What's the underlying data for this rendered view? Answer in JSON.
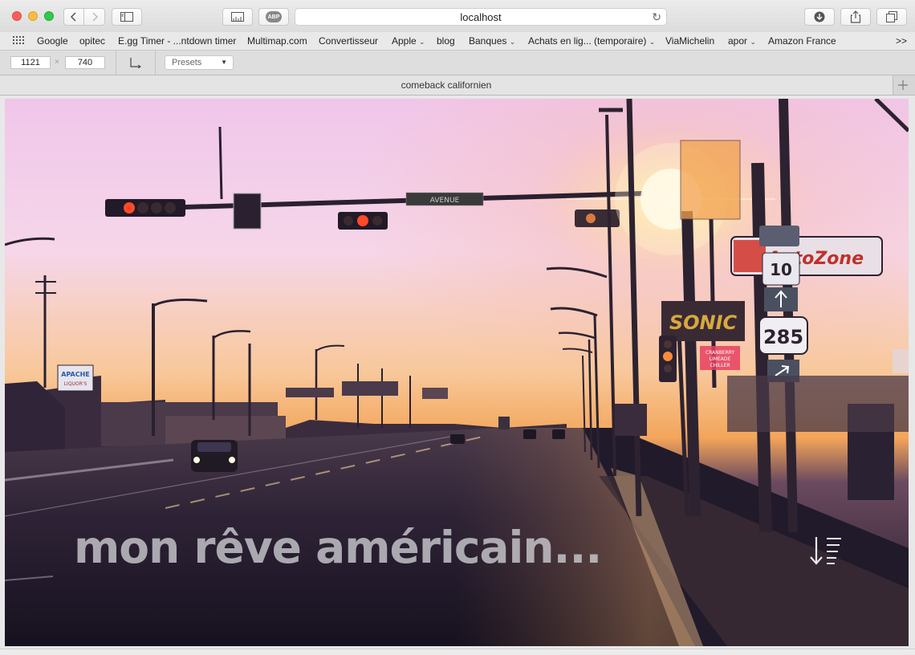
{
  "window": {
    "address": "localhost",
    "tab_title": "comeback californien"
  },
  "toolbar": {
    "back_icon": "chevron-left-icon",
    "forward_icon": "chevron-right-icon",
    "sidebar_icon": "sidebar-icon",
    "responsive_icon": "responsive-design-icon",
    "adblock_label": "ABP",
    "reload_icon": "reload-icon",
    "download_icon": "download-icon",
    "share_icon": "share-icon",
    "tabs_icon": "tabs-overview-icon"
  },
  "bookmarks": [
    {
      "label": "Google",
      "has_menu": false
    },
    {
      "label": "opitec",
      "has_menu": false
    },
    {
      "label": "E.gg Timer - ...ntdown timer",
      "has_menu": false
    },
    {
      "label": "Multimap.com",
      "has_menu": false
    },
    {
      "label": "Convertisseur",
      "has_menu": false
    },
    {
      "label": "Apple",
      "has_menu": true
    },
    {
      "label": "blog",
      "has_menu": false
    },
    {
      "label": "Banques",
      "has_menu": true
    },
    {
      "label": "Achats en lig... (temporaire)",
      "has_menu": true
    },
    {
      "label": "ViaMichelin",
      "has_menu": false
    },
    {
      "label": "apor",
      "has_menu": true
    },
    {
      "label": "Amazon France",
      "has_menu": false
    }
  ],
  "bookmarks_overflow": ">>",
  "responsive": {
    "width": "1121",
    "separator": "×",
    "height": "740",
    "presets_label": "Presets"
  },
  "page": {
    "hero_title": "mon rêve américain...",
    "scroll_icon": "sort-down-icon",
    "photo_signs": {
      "street": "AVENUE",
      "store": "APACHE LIQUOR'S",
      "autozone": "AutoZone",
      "sonic": "SONIC",
      "limeade": "CRANBERRY LIMEADE CHILLER",
      "route_10": "10",
      "route_285": "285"
    }
  },
  "colors": {
    "sky_top": "#f3c8e8",
    "sky_horizon": "#f6b46a",
    "sun": "#fff6d8",
    "road": "#2a2233",
    "close": "#fc605c",
    "minimize": "#fdbc40",
    "maximize": "#34c84a"
  }
}
